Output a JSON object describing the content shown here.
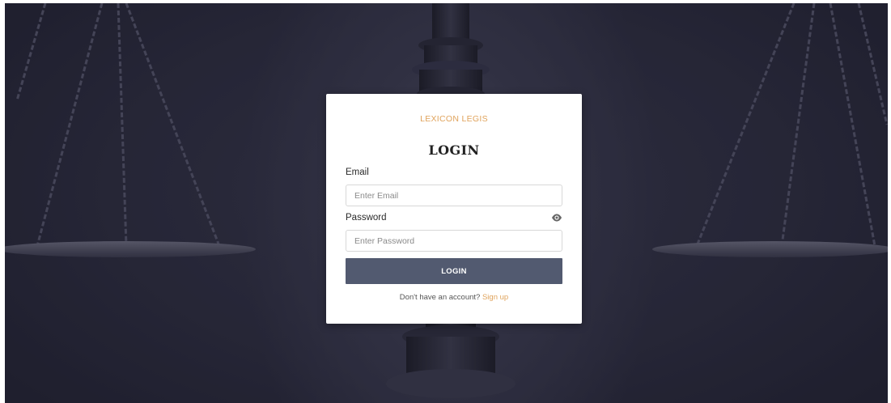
{
  "background": {
    "description_icon": "scales-of-justice-image",
    "base_color": "#2c2c3e"
  },
  "login_card": {
    "brand": "LEXICON LEGIS",
    "title": "LOGIN",
    "email": {
      "label": "Email",
      "placeholder": "Enter Email",
      "value": ""
    },
    "password": {
      "label": "Password",
      "placeholder": "Enter Password",
      "value": "",
      "toggle_icon": "eye-icon"
    },
    "submit_label": "LOGIN",
    "signup_prompt": "Don't have an account?",
    "signup_link": "Sign up"
  },
  "colors": {
    "accent": "#e0a35c",
    "button": "#525a70",
    "card": "#ffffff"
  }
}
